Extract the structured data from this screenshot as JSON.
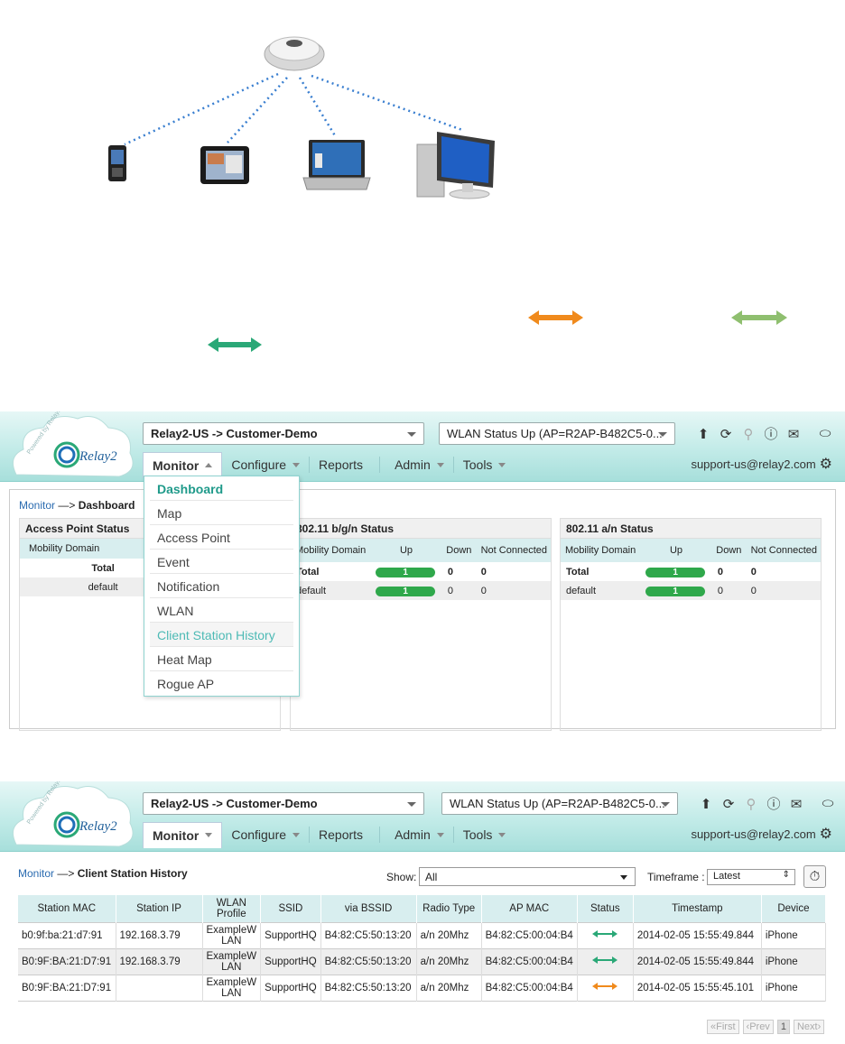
{
  "dashboard": {
    "header": {
      "org_select": "Relay2-US -> Customer-Demo",
      "wlan_status": "WLAN Status Up (AP=R2AP-B482C5-0...",
      "nav": {
        "monitor": "Monitor",
        "configure": "Configure",
        "reports": "Reports",
        "admin": "Admin",
        "tools": "Tools"
      },
      "support": "support-us@relay2.com",
      "brand": "Relay2",
      "powered": "Powered by Relay2"
    },
    "breadcrumb": {
      "root": "Monitor",
      "arrow": "—>",
      "current": "Dashboard"
    },
    "menu": [
      "Dashboard",
      "Map",
      "Access Point",
      "Event",
      "Notification",
      "WLAN",
      "Client Station History",
      "Heat Map",
      "Rogue AP"
    ],
    "ap_status": {
      "title": "Access Point Status",
      "col": "Mobility Domain",
      "rows": [
        {
          "domain": "Total"
        },
        {
          "domain": "default"
        }
      ]
    },
    "bgn": {
      "title": "802.11 b/g/n Status",
      "cols": [
        "Mobility Domain",
        "Up",
        "Down",
        "Not Connected"
      ],
      "rows": [
        {
          "domain": "Total",
          "up": "1",
          "down": "0",
          "nc": "0"
        },
        {
          "domain": "default",
          "up": "1",
          "down": "0",
          "nc": "0"
        }
      ]
    },
    "an": {
      "title": "802.11 a/n Status",
      "cols": [
        "Mobility Domain",
        "Up",
        "Down",
        "Not Connected"
      ],
      "rows": [
        {
          "domain": "Total",
          "up": "1",
          "down": "0",
          "nc": "0"
        },
        {
          "domain": "default",
          "up": "1",
          "down": "0",
          "nc": "0"
        }
      ]
    }
  },
  "history": {
    "breadcrumb": {
      "root": "Monitor",
      "arrow": "—>",
      "current": "Client Station History"
    },
    "show_label": "Show:",
    "show_value": "All",
    "timeframe_label": "Timeframe :",
    "timeframe_value": "Latest",
    "columns": [
      "Station MAC",
      "Station IP",
      "WLAN Profile",
      "SSID",
      "via BSSID",
      "Radio Type",
      "AP MAC",
      "Status",
      "Timestamp",
      "Device"
    ],
    "rows": [
      {
        "mac": "b0:9f:ba:21:d7:91",
        "ip": "192.168.3.79",
        "profile": "ExampleW LAN",
        "ssid": "SupportHQ",
        "bssid": "B4:82:C5:50:13:20",
        "radio": "a/n 20Mhz",
        "apmac": "B4:82:C5:00:04:B4",
        "status": "connected",
        "ts": "2014-02-05 15:55:49.844",
        "device": "iPhone"
      },
      {
        "mac": "B0:9F:BA:21:D7:91",
        "ip": "192.168.3.79",
        "profile": "ExampleW LAN",
        "ssid": "SupportHQ",
        "bssid": "B4:82:C5:50:13:20",
        "radio": "a/n 20Mhz",
        "apmac": "B4:82:C5:00:04:B4",
        "status": "connected",
        "ts": "2014-02-05 15:55:49.844",
        "device": "iPhone"
      },
      {
        "mac": "B0:9F:BA:21:D7:91",
        "ip": "",
        "profile": "ExampleW LAN",
        "ssid": "SupportHQ",
        "bssid": "B4:82:C5:50:13:20",
        "radio": "a/n 20Mhz",
        "apmac": "B4:82:C5:00:04:B4",
        "status": "associated",
        "ts": "2014-02-05 15:55:45.101",
        "device": "iPhone"
      }
    ],
    "pager": {
      "first": "First",
      "prev": "Prev",
      "page": "1",
      "next": "Next"
    }
  },
  "colors": {
    "green_arrow": "#2aa877",
    "orange_arrow": "#f08a1c",
    "lightgreen_arrow": "#8fbf6f",
    "accent": "#1f9a8a"
  }
}
